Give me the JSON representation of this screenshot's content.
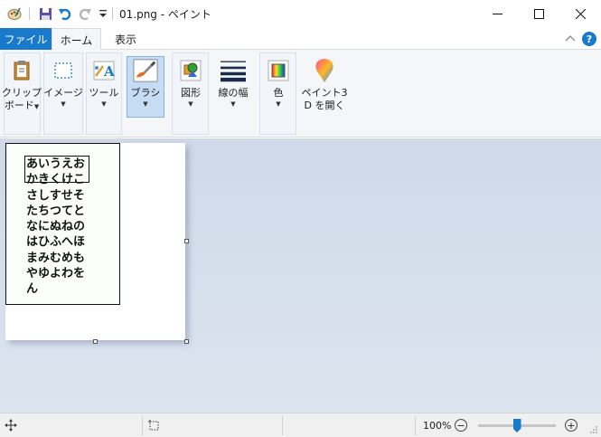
{
  "window": {
    "title": "01.png - ペイント",
    "minimize": "—",
    "maximize": "☐",
    "close": "✕"
  },
  "tabs": {
    "file": "ファイル",
    "home": "ホーム",
    "view": "表示"
  },
  "ribbon": {
    "clipboard": {
      "label1": "クリップ",
      "label2": "ボード"
    },
    "image": {
      "label": "イメージ"
    },
    "tools": {
      "label": "ツール"
    },
    "brush": {
      "label": "ブラシ"
    },
    "shapes": {
      "label": "図形"
    },
    "size": {
      "label": "線の幅"
    },
    "color": {
      "label": "色"
    },
    "paint3d": {
      "label1": "ペイント3",
      "label2": "D を開く"
    },
    "help": "?",
    "colors": {
      "accent": "#1979ca",
      "active_bg": "#c5dcf2"
    }
  },
  "canvas": {
    "text": "あいうえおかきくけこさしすせそたちつてとなにぬねのはひふへほまみむめもやゆよわをん"
  },
  "status": {
    "zoom": "100%",
    "zoom_out": "−",
    "zoom_in": "+",
    "zoom_level": 0.5
  }
}
